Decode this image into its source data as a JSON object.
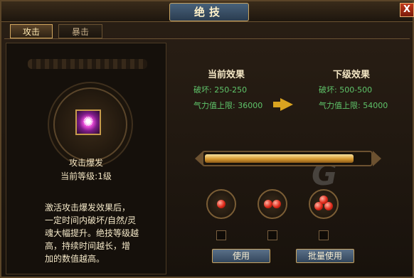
{
  "window": {
    "title": "绝技",
    "close_label": "X"
  },
  "tabs": [
    {
      "label": "攻击",
      "active": true
    },
    {
      "label": "暴击",
      "active": false
    }
  ],
  "skill": {
    "name": "攻击爆发",
    "level_text": "当前等级:1级",
    "description_lines": [
      "激活攻击爆发效果后，",
      "一定时间内破坏/自然/灵",
      "魂大幅提升。绝技等级越",
      "高，持续时间越长，增",
      "加的数值越高。"
    ]
  },
  "current_effect": {
    "title": "当前效果",
    "line1": "破坏: 250-250",
    "line2": "气力值上限: 36000"
  },
  "next_effect": {
    "title": "下级效果",
    "line1": "破坏: 500-500",
    "line2": "气力值上限: 54000"
  },
  "progress": {
    "fraction": 0.9
  },
  "items": [
    {
      "orbs": 1
    },
    {
      "orbs": 2
    },
    {
      "orbs": 3
    }
  ],
  "buttons": {
    "use": "使用",
    "batch_use": "批量使用"
  },
  "watermark": "G",
  "colors": {
    "effect_text": "#5fc46a",
    "accent": "#d9a320"
  }
}
